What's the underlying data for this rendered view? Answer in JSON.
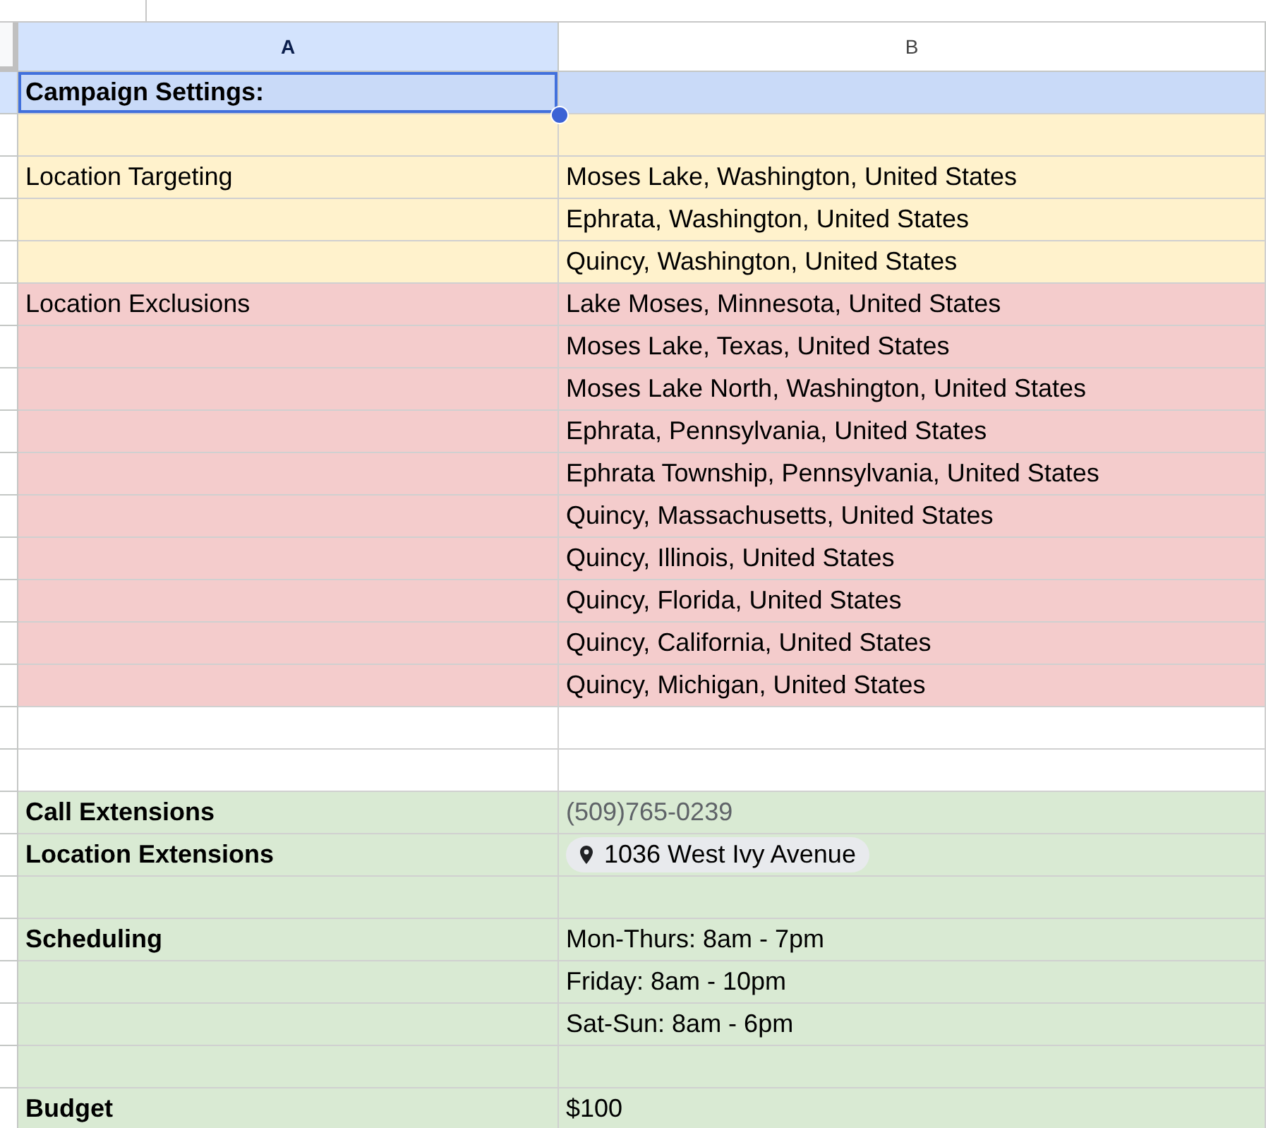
{
  "columns": [
    {
      "label": "A",
      "selected": true
    },
    {
      "label": "B",
      "selected": false
    }
  ],
  "rows": [
    {
      "color": "#c9daf8",
      "a": {
        "text": "Campaign Settings:",
        "kind": "heading",
        "selected": true
      }
    },
    {
      "color": "#fff2cc"
    },
    {
      "color": "#fff2cc",
      "a": {
        "text": "Location Targeting",
        "kind": "text",
        "selected": false
      },
      "b": {
        "text": "Moses Lake, Washington, United States",
        "kind": "text",
        "selected": false
      }
    },
    {
      "color": "#fff2cc",
      "b": {
        "text": "Ephrata, Washington, United States",
        "kind": "text",
        "selected": false
      }
    },
    {
      "color": "#fff2cc",
      "b": {
        "text": "Quincy, Washington, United States",
        "kind": "text",
        "selected": false
      }
    },
    {
      "color": "#f4cccc",
      "a": {
        "text": "Location Exclusions",
        "kind": "text",
        "selected": false
      },
      "b": {
        "text": "Lake Moses, Minnesota, United States",
        "kind": "text",
        "selected": false
      }
    },
    {
      "color": "#f4cccc",
      "b": {
        "text": "Moses Lake, Texas, United States",
        "kind": "text",
        "selected": false
      }
    },
    {
      "color": "#f4cccc",
      "b": {
        "text": "Moses Lake North, Washington, United States",
        "kind": "text",
        "selected": false
      }
    },
    {
      "color": "#f4cccc",
      "b": {
        "text": "Ephrata, Pennsylvania, United States",
        "kind": "text",
        "selected": false
      }
    },
    {
      "color": "#f4cccc",
      "b": {
        "text": "Ephrata Township, Pennsylvania, United States",
        "kind": "text",
        "selected": false
      }
    },
    {
      "color": "#f4cccc",
      "b": {
        "text": "Quincy, Massachusetts, United States",
        "kind": "text",
        "selected": false
      }
    },
    {
      "color": "#f4cccc",
      "b": {
        "text": "Quincy, Illinois, United States",
        "kind": "text",
        "selected": false
      }
    },
    {
      "color": "#f4cccc",
      "b": {
        "text": "Quincy, Florida, United States",
        "kind": "text",
        "selected": false
      }
    },
    {
      "color": "#f4cccc",
      "b": {
        "text": "Quincy, California, United States",
        "kind": "text",
        "selected": false
      }
    },
    {
      "color": "#f4cccc",
      "b": {
        "text": "Quincy, Michigan, United States",
        "kind": "text",
        "selected": false
      }
    },
    {},
    {},
    {
      "color": "#d9ead3",
      "a": {
        "text": "Call Extensions",
        "kind": "heading",
        "selected": false
      },
      "b": {
        "text": "(509)765-0239",
        "kind": "phone",
        "selected": false
      }
    },
    {
      "color": "#d9ead3",
      "a": {
        "text": "Location Extensions",
        "kind": "heading",
        "selected": false
      },
      "b": {
        "text": "1036 West Ivy Avenue",
        "kind": "place",
        "selected": false
      }
    },
    {
      "color": "#d9ead3"
    },
    {
      "color": "#d9ead3",
      "a": {
        "text": "Scheduling",
        "kind": "heading",
        "selected": false
      },
      "b": {
        "text": "Mon-Thurs: 8am - 7pm",
        "kind": "text",
        "selected": false
      }
    },
    {
      "color": "#d9ead3",
      "b": {
        "text": "Friday: 8am - 10pm",
        "kind": "text",
        "selected": false
      }
    },
    {
      "color": "#d9ead3",
      "b": {
        "text": "Sat-Sun: 8am - 6pm",
        "kind": "text",
        "selected": false
      }
    },
    {
      "color": "#d9ead3"
    },
    {
      "color": "#d9ead3",
      "a": {
        "text": "Budget",
        "kind": "heading",
        "selected": false
      },
      "b": {
        "text": "$100",
        "kind": "text",
        "selected": false
      }
    }
  ]
}
